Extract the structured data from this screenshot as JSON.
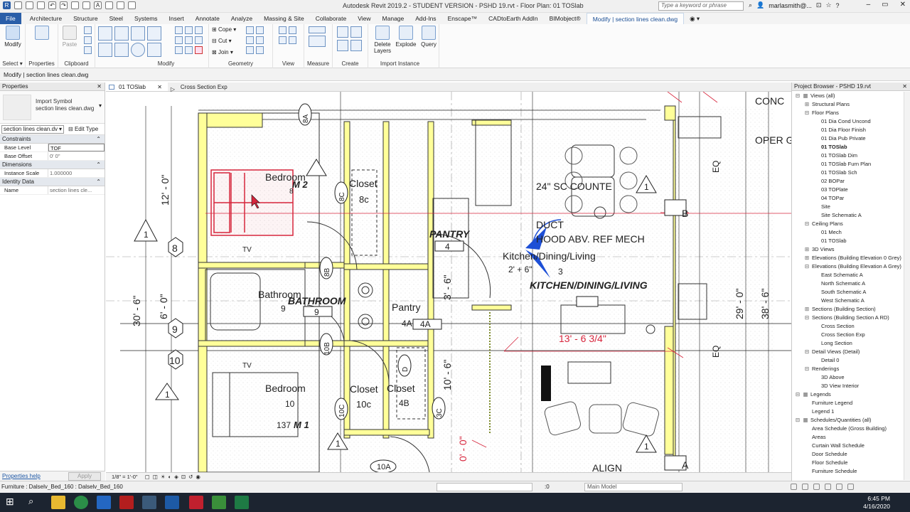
{
  "window": {
    "title": "Autodesk Revit 2019.2 - STUDENT VERSION - PSHD 19.rvt - Floor Plan: 01 TOSlab",
    "search_placeholder": "Type a keyword or phrase",
    "user": "marlasmith@..."
  },
  "tabs": [
    "File",
    "Architecture",
    "Structure",
    "Steel",
    "Systems",
    "Insert",
    "Annotate",
    "Analyze",
    "Massing & Site",
    "Collaborate",
    "View",
    "Manage",
    "Add-Ins",
    "Enscape™",
    "CADtoEarth AddIn",
    "BIMobject®",
    "Modify | section lines clean.dwg"
  ],
  "ribbon": {
    "modify_label": "Modify",
    "select_label": "Select ▾",
    "properties_label": "Properties",
    "clipboard": {
      "label": "Clipboard",
      "paste": "Paste"
    },
    "geometry": {
      "label": "Geometry",
      "cope": "Cope",
      "cut": "Cut",
      "join": "Join"
    },
    "modify_group": "Modify",
    "view_group": "View",
    "measure_group": "Measure",
    "create_group": "Create",
    "import_instance": {
      "label": "Import Instance",
      "delete_layers": "Delete Layers",
      "explode": "Explode",
      "query": "Query"
    }
  },
  "context_bar": "Modify | section lines clean.dwg",
  "properties": {
    "title": "Properties",
    "type_name": "Import Symbol\nsection lines clean.dwg",
    "instance_selector": "section lines clean.dv",
    "edit_type": "Edit Type",
    "categories": [
      {
        "name": "Constraints",
        "rows": [
          {
            "k": "Base Level",
            "v": "TOF",
            "editable": true
          },
          {
            "k": "Base Offset",
            "v": "0' 0\"",
            "editable": false
          }
        ]
      },
      {
        "name": "Dimensions",
        "rows": [
          {
            "k": "Instance Scale",
            "v": "1.000000",
            "editable": false
          }
        ]
      },
      {
        "name": "Identity Data",
        "rows": [
          {
            "k": "Name",
            "v": "section lines cle...",
            "editable": false
          }
        ]
      }
    ],
    "help_link": "Properties help",
    "apply": "Apply"
  },
  "view_tabs": [
    {
      "label": "01 TOSlab",
      "active": true
    },
    {
      "label": "Cross Section Exp",
      "active": false
    }
  ],
  "view_bar": {
    "scale": "1/8\" = 1'-0\""
  },
  "drawing": {
    "rooms": [
      {
        "name": "Bedroom",
        "num": "8",
        "tag": "M 2"
      },
      {
        "name": "Closet",
        "num": "8c"
      },
      {
        "name": "PANTRY",
        "num": "4"
      },
      {
        "name": "Kitchen/Dining/Living",
        "num": "3"
      },
      {
        "name": "KITCHEN/DINING/LIVING"
      },
      {
        "name": "Bathroom",
        "num": "9"
      },
      {
        "name": "BATHROOM",
        "num": "9"
      },
      {
        "name": "Pantry",
        "num": "4A",
        "tag": "4A"
      },
      {
        "name": "Bedroom",
        "num": "10",
        "tag": "M 1"
      },
      {
        "name": "Closet",
        "num": "10c"
      },
      {
        "name": "Closet",
        "num": "4B"
      }
    ],
    "labels": {
      "hood": "HOOD ABV. REF MECH",
      "duct": "DUCT",
      "counter": "24\" SC COUNTE",
      "dim_main": "13' - 6 3/4\"",
      "dim_2_6": "2' + 6\"",
      "align": "ALIGN",
      "conc": "CONC",
      "oper": "OPER GLAZ",
      "eq": "EQ",
      "dim_12": "12' - 0\"",
      "dim_30": "30' - 6\"",
      "dim_6": "6' - 0\"",
      "dim_3": "3' - 6\"",
      "dim_10": "10' - 6\"",
      "dim_29": "29' - 0\"",
      "dim_38": "38' - 6\"",
      "dim_0": "0' - 0\"",
      "hex_tags": [
        "8",
        "9",
        "10"
      ],
      "door_tags": [
        "8A",
        "8C",
        "8B",
        "10B",
        "10C",
        "10A",
        "3C",
        "D"
      ],
      "grid_b": "B",
      "grid_a": "A",
      "tv": "TV",
      "tri": [
        "1",
        "1",
        "1",
        "1",
        "1"
      ],
      "one_half": "137"
    }
  },
  "project_browser": {
    "title": "Project Browser - PSHD 19.rvt",
    "nodes": [
      {
        "label": "Views (all)",
        "level": 0,
        "toggle": "−",
        "icon": true
      },
      {
        "label": "Structural Plans",
        "level": 1,
        "toggle": "+"
      },
      {
        "label": "Floor Plans",
        "level": 1,
        "toggle": "−"
      },
      {
        "label": "01 Dia Cond Uncond",
        "level": 2
      },
      {
        "label": "01 Dia Floor Finish",
        "level": 2
      },
      {
        "label": "01 Dia Pub Private",
        "level": 2
      },
      {
        "label": "01 TOSlab",
        "level": 2,
        "bold": true
      },
      {
        "label": "01 TOSlab Dim",
        "level": 2
      },
      {
        "label": "01 TOSlab Furn Plan",
        "level": 2
      },
      {
        "label": "01 TOSlab Sch",
        "level": 2
      },
      {
        "label": "02 BOPar",
        "level": 2
      },
      {
        "label": "03 TOPlate",
        "level": 2
      },
      {
        "label": "04 TOPar",
        "level": 2
      },
      {
        "label": "Site",
        "level": 2
      },
      {
        "label": "Site Schematic A",
        "level": 2
      },
      {
        "label": "Ceiling Plans",
        "level": 1,
        "toggle": "−"
      },
      {
        "label": "01 Mech",
        "level": 2
      },
      {
        "label": "01 TOSlab",
        "level": 2
      },
      {
        "label": "3D Views",
        "level": 1,
        "toggle": "+"
      },
      {
        "label": "Elevations (Building Elevation 0 Grey)",
        "level": 1,
        "toggle": "+"
      },
      {
        "label": "Elevations (Building Elevation A Grey)",
        "level": 1,
        "toggle": "−"
      },
      {
        "label": "East Schematic A",
        "level": 2
      },
      {
        "label": "North Schematic A",
        "level": 2
      },
      {
        "label": "South Schematic A",
        "level": 2
      },
      {
        "label": "West Schematic A",
        "level": 2
      },
      {
        "label": "Sections (Building Section)",
        "level": 1,
        "toggle": "+"
      },
      {
        "label": "Sections (Building Section A RD)",
        "level": 1,
        "toggle": "−"
      },
      {
        "label": "Cross Section",
        "level": 2
      },
      {
        "label": "Cross Section Exp",
        "level": 2
      },
      {
        "label": "Long Section",
        "level": 2
      },
      {
        "label": "Detail Views (Detail)",
        "level": 1,
        "toggle": "−"
      },
      {
        "label": "Detail 0",
        "level": 2
      },
      {
        "label": "Renderings",
        "level": 1,
        "toggle": "−"
      },
      {
        "label": "3D Above",
        "level": 2
      },
      {
        "label": "3D View Interior",
        "level": 2
      },
      {
        "label": "Legends",
        "level": 0,
        "toggle": "−",
        "icon": true
      },
      {
        "label": "Furniture Legend",
        "level": 1
      },
      {
        "label": "Legend 1",
        "level": 1
      },
      {
        "label": "Schedules/Quantities (all)",
        "level": 0,
        "toggle": "−",
        "icon": true
      },
      {
        "label": "Area Schedule (Gross Building)",
        "level": 1
      },
      {
        "label": "Areas",
        "level": 1
      },
      {
        "label": "Curtain Wall Schedule",
        "level": 1
      },
      {
        "label": "Door Schedule",
        "level": 1
      },
      {
        "label": "Floor Schedule",
        "level": 1
      },
      {
        "label": "Furniture Schedule",
        "level": 1
      }
    ]
  },
  "status": {
    "text": "Furniture : Dalselv_Bed_160 : Dalselv_Bed_160",
    "zero": ":0",
    "model": "Main Model"
  },
  "taskbar": {
    "time": "6:45 PM",
    "date": "4/16/2020"
  },
  "colors": {
    "accent": "#2a5ea8",
    "wall_fill": "#ffff99",
    "highlight": "#d7263d",
    "section_blue": "#1d4fd6"
  }
}
